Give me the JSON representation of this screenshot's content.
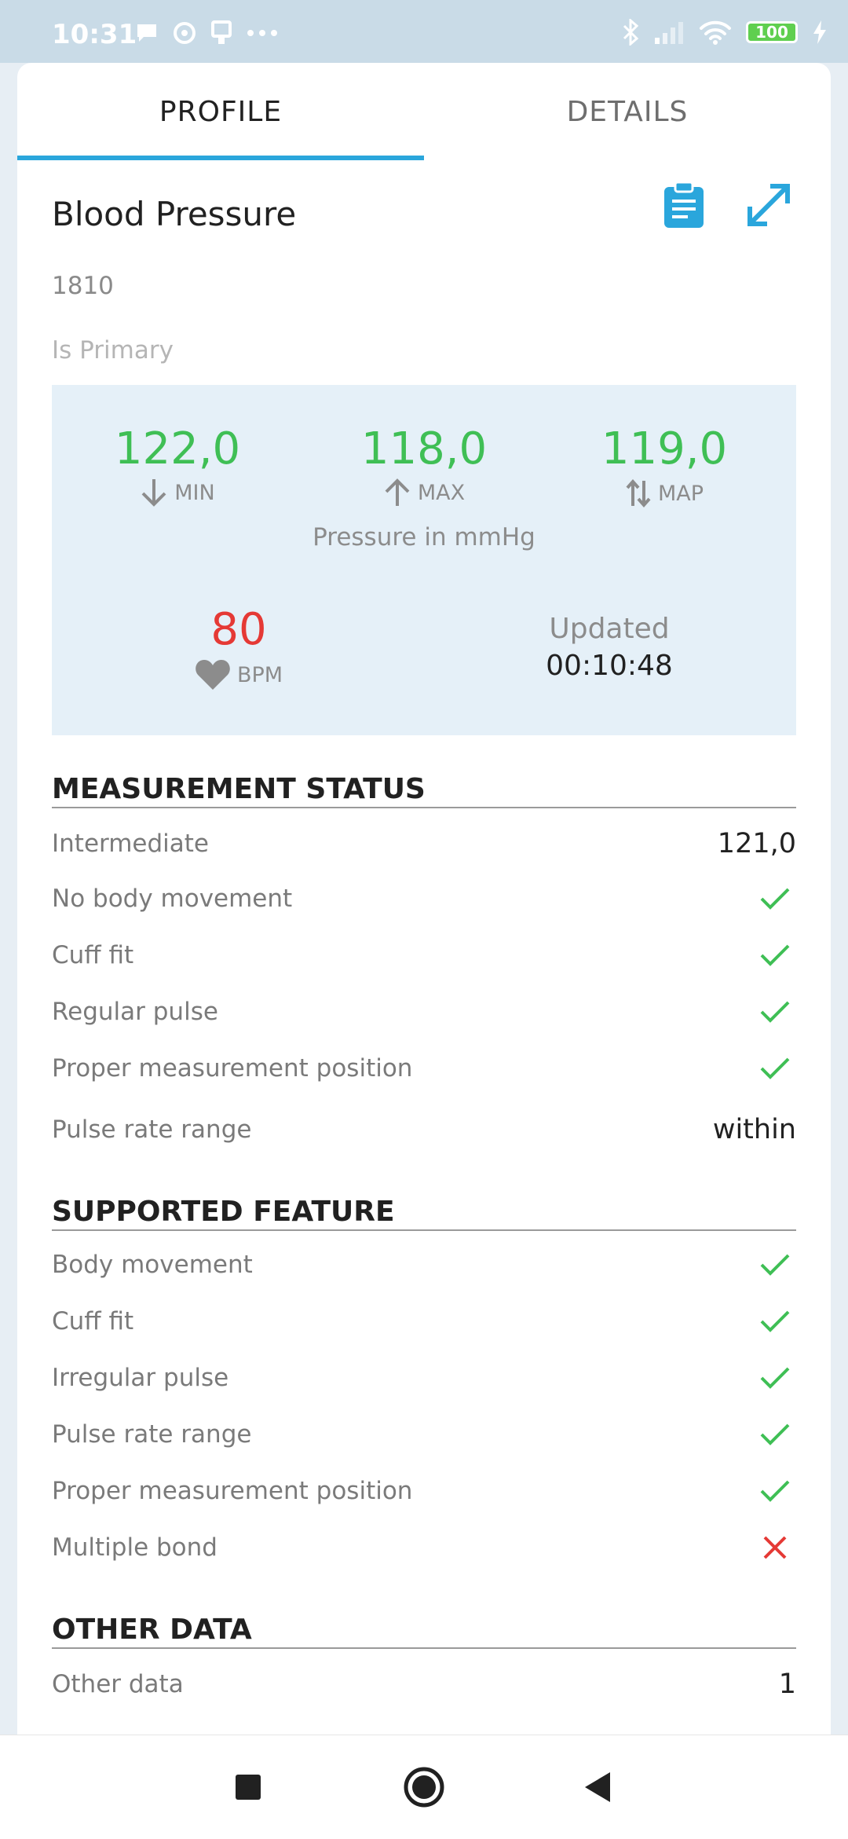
{
  "status_bar": {
    "time": "10:31",
    "battery": "100",
    "icons": [
      "chat-icon",
      "chrome-icon",
      "cast-icon",
      "more-icon",
      "bluetooth-icon",
      "signal-icon",
      "wifi-icon",
      "battery-icon",
      "charging-icon"
    ]
  },
  "tabs": [
    {
      "label": "PROFILE",
      "selected": true
    },
    {
      "label": "DETAILS",
      "selected": false
    }
  ],
  "profile": {
    "title": "Blood Pressure",
    "id": "1810",
    "primary_label": "Is Primary"
  },
  "actions": [
    "clipboard-icon",
    "expand-icon"
  ],
  "readings": {
    "min": {
      "value": "122,0",
      "label": "MIN"
    },
    "max": {
      "value": "118,0",
      "label": "MAX"
    },
    "map": {
      "value": "119,0",
      "label": "MAP"
    },
    "pressure_caption": "Pressure in mmHg",
    "pulse": {
      "value": "80",
      "label": "BPM"
    },
    "updated": {
      "label": "Updated",
      "value": "00:10:48"
    }
  },
  "measurement_status": {
    "title": "MEASUREMENT STATUS",
    "rows": [
      {
        "label": "Intermediate",
        "value": "121,0"
      },
      {
        "label": "No body movement",
        "status": "check"
      },
      {
        "label": "Cuff fit",
        "status": "check"
      },
      {
        "label": "Regular pulse",
        "status": "check"
      },
      {
        "label": "Proper measurement position",
        "status": "check"
      },
      {
        "label": "Pulse rate range",
        "value": "within"
      }
    ]
  },
  "supported_feature": {
    "title": "SUPPORTED FEATURE",
    "rows": [
      {
        "label": "Body movement",
        "status": "check"
      },
      {
        "label": "Cuff fit",
        "status": "check"
      },
      {
        "label": "Irregular pulse",
        "status": "check"
      },
      {
        "label": "Pulse rate range",
        "status": "check"
      },
      {
        "label": "Proper measurement position",
        "status": "check"
      },
      {
        "label": "Multiple bond",
        "status": "cross"
      }
    ]
  },
  "other_data": {
    "title": "OTHER DATA",
    "rows": [
      {
        "label": "Other data",
        "value": "1"
      }
    ]
  },
  "colors": {
    "accent": "#2aa6dc",
    "good": "#3fbf55",
    "bad": "#e53935",
    "panel": "#e5f0f8"
  },
  "nav": [
    "recents-icon",
    "home-icon",
    "back-icon"
  ]
}
